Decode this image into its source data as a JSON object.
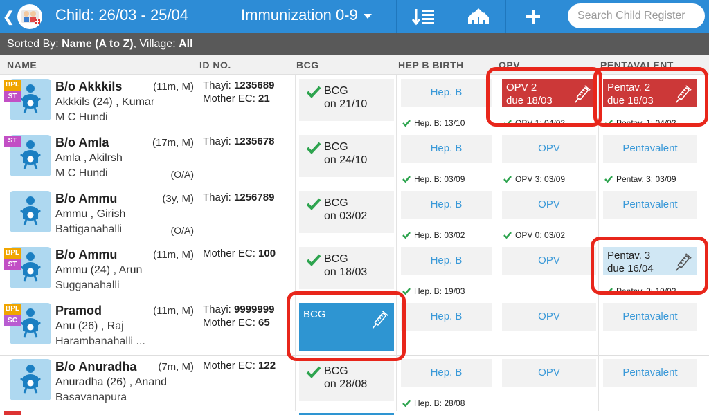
{
  "header": {
    "title": "Child: 26/03 - 25/04",
    "filter": "Immunization 0-9",
    "search_placeholder": "Search Child Register"
  },
  "sortbar": {
    "prefix": "Sorted By: ",
    "sort_value": "Name (A to Z)",
    "village_label": ", Village: ",
    "village_value": "All"
  },
  "columns": {
    "name": "NAME",
    "id": "ID NO.",
    "bcg": "BCG",
    "hep": "HEP B BIRTH",
    "opv": "OPV",
    "pent": "PENTAVALENT"
  },
  "rows": [
    {
      "name": "B/o Akkkils",
      "age": "(11m, M)",
      "parents": "Akkkils (24) , Kumar",
      "village": "M C Hundi",
      "oa": "",
      "id_line1_label": "Thayi: ",
      "id_line1_value": "1235689",
      "id_line2_label": "Mother EC: ",
      "id_line2_value": "21",
      "badges": [
        "BPL",
        "ST"
      ],
      "bcg_line1": "BCG",
      "bcg_line2": "on 21/10",
      "hep_link": "Hep. B",
      "hep_done": "Hep. B: 13/10",
      "opv_due1": "OPV 2",
      "opv_due2": "due 18/03",
      "opv_done": "OPV 1: 04/02",
      "pent_due1": "Pentav. 2",
      "pent_due2": "due 18/03",
      "pent_done": "Pentav. 1: 04/02"
    },
    {
      "name": "B/o Amla",
      "age": "(17m, M)",
      "parents": "Amla , Akilrsh",
      "village": "M C Hundi",
      "oa": "(O/A)",
      "id_line1_label": "Thayi: ",
      "id_line1_value": "1235678",
      "badges": [
        "ST"
      ],
      "bcg_line1": "BCG",
      "bcg_line2": "on 24/10",
      "hep_link": "Hep. B",
      "hep_done": "Hep. B: 03/09",
      "opv_link": "OPV",
      "opv_done": "OPV 3: 03/09",
      "pent_link": "Pentavalent",
      "pent_done": "Pentav. 3: 03/09"
    },
    {
      "name": "B/o Ammu",
      "age": "(3y, M)",
      "parents": "Ammu , Girish",
      "village": "Battiganahalli",
      "oa": "(O/A)",
      "id_line1_label": "Thayi: ",
      "id_line1_value": "1256789",
      "badges": [],
      "bcg_line1": "BCG",
      "bcg_line2": "on 03/02",
      "hep_link": "Hep. B",
      "hep_done": "Hep. B: 03/02",
      "opv_link": "OPV",
      "opv_done": "OPV 0: 03/02",
      "pent_link": "Pentavalent"
    },
    {
      "name": "B/o Ammu",
      "age": "(11m, M)",
      "parents": "Ammu (24) , Arun",
      "village": "Sugganahalli",
      "oa": "",
      "id_line1_label": "Mother EC: ",
      "id_line1_value": "100",
      "badges": [
        "BPL",
        "ST"
      ],
      "bcg_line1": "BCG",
      "bcg_line2": "on 18/03",
      "hep_link": "Hep. B",
      "hep_done": "Hep. B: 19/03",
      "opv_link": "OPV",
      "pent_due1": "Pentav. 3",
      "pent_due2": "due 16/04",
      "pent_done": "Pentav. 2: 19/03"
    },
    {
      "name": "Pramod",
      "age": "(11m, M)",
      "parents": "Anu (26) , Raj",
      "village": "Harambanahalli ...",
      "oa": "",
      "id_line1_label": "Thayi: ",
      "id_line1_value": "9999999",
      "id_line2_label": "Mother EC: ",
      "id_line2_value": "65",
      "badges": [
        "BPL",
        "SC"
      ],
      "bcg_due": "BCG",
      "hep_link": "Hep. B",
      "opv_link": "OPV",
      "pent_link": "Pentavalent"
    },
    {
      "name": "B/o Anuradha",
      "age": "(7m, M)",
      "parents": "Anuradha (26) , Anand",
      "village": "Basavanapura",
      "oa": "",
      "id_line1_label": "Mother EC: ",
      "id_line1_value": "122",
      "badges": [],
      "bcg_line1": "BCG",
      "bcg_line2": "on 28/08",
      "hep_link": "Hep. B",
      "hep_done": "Hep. B: 28/08",
      "opv_link": "OPV",
      "pent_link": "Pentavalent"
    }
  ],
  "colors": {
    "topbar": "#2d8cd6",
    "sortbar": "#595959",
    "overdue": "#cc3838",
    "upcoming": "#d0e7f4",
    "due_now": "#2e95d2",
    "highlight": "#e8261b",
    "check": "#2ea44f"
  }
}
